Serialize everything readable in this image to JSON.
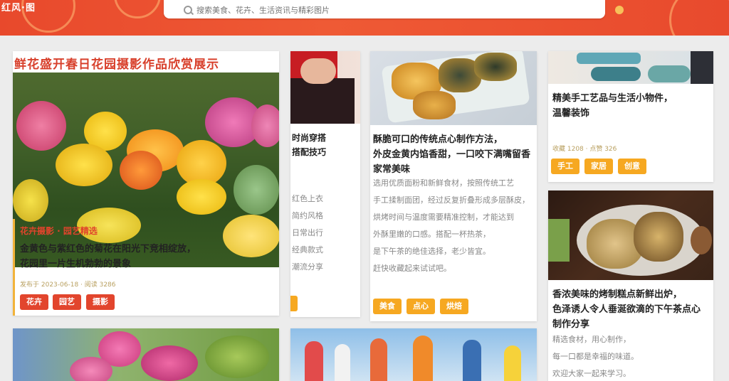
{
  "header": {
    "logo": "红风·图",
    "search_placeholder": "搜索美食、花卉、生活资讯与精彩图片",
    "accent": "#e8492c"
  },
  "cards": {
    "main": {
      "banner": "鲜花盛开春日花园摄影作品欣赏展示",
      "category": "花卉摄影 · 园艺精选",
      "title_lines": [
        "金黄色与紫红色的菊花在阳光下竞相绽放，",
        "花园里一片生机勃勃的景象"
      ],
      "meta": "发布于 2023-06-18 · 阅读 3286",
      "tags": [
        "花卉",
        "园艺",
        "摄影"
      ]
    },
    "person": {
      "text_lines": [
        "时尚穿搭",
        "搭配技巧",
        "红色上衣",
        "简约风格",
        "日常出行",
        "经典款式",
        "潮流分享"
      ]
    },
    "food1": {
      "title_lines": [
        "酥脆可口的传统点心制作方法，",
        "外皮金黄内馅香甜，一口咬下满嘴留香",
        "家常美味"
      ],
      "text_lines": [
        "选用优质面粉和新鲜食材，按照传统工艺",
        "手工揉制面团，经过反复折叠形成多层酥皮，",
        "烘烤时间与温度需要精准控制，才能达到",
        "外酥里嫩的口感。搭配一杯热茶，",
        "是下午茶的绝佳选择，老少皆宜。",
        "赶快收藏起来试试吧。"
      ],
      "tags": [
        "美食",
        "点心",
        "烘焙"
      ]
    },
    "craft": {
      "title_lines": [
        "精美手工艺品与生活小物件，",
        "温馨装饰"
      ],
      "meta": "收藏 1208 · 点赞 326",
      "tags": [
        "手工",
        "家居",
        "创意"
      ]
    },
    "food2": {
      "title_lines": [
        "香浓美味的烤制糕点新鲜出炉，",
        "色泽诱人令人垂涎欲滴的下午茶点心",
        "制作分享"
      ],
      "text_lines": [
        "精选食材，用心制作，",
        "每一口都是幸福的味道。",
        "欢迎大家一起来学习。"
      ]
    }
  }
}
